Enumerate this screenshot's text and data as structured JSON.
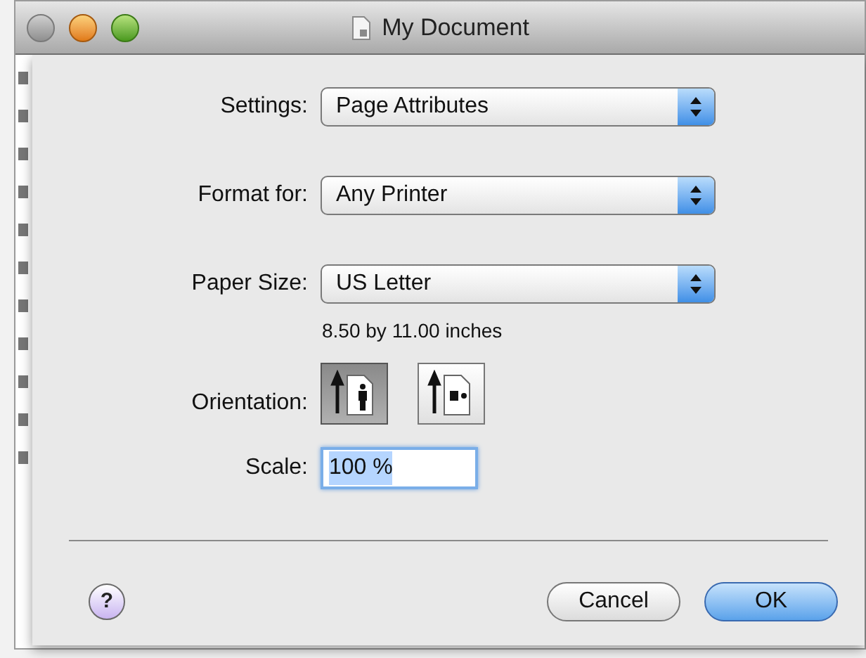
{
  "window": {
    "title": "My Document"
  },
  "popups": [
    {
      "label": "Settings:",
      "value": "Page Attributes"
    },
    {
      "label": "Format for:",
      "value": "Any Printer"
    },
    {
      "label": "Paper Size:",
      "value": "US Letter"
    }
  ],
  "paper_size_note": "8.50 by 11.00 inches",
  "orientation": {
    "label": "Orientation:",
    "options": [
      {
        "kind": "portrait",
        "selected": true
      },
      {
        "kind": "landscape",
        "selected": false
      }
    ]
  },
  "scale": {
    "label": "Scale:",
    "value": "100 %"
  },
  "help_button": {
    "label": "?"
  },
  "buttons": [
    {
      "label": "Cancel",
      "default": false
    },
    {
      "label": "OK",
      "default": true
    }
  ]
}
